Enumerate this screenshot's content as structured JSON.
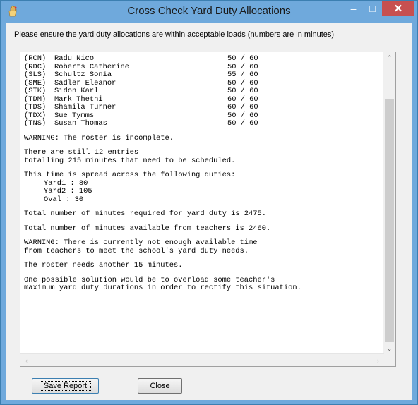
{
  "window": {
    "title": "Cross Check Yard Duty Allocations",
    "minimize_glyph": "–",
    "maximize_glyph": "□",
    "close_glyph": "✕",
    "app_icon": "hand-icon"
  },
  "instruction": "Please ensure the yard duty allocations are within acceptable loads (numbers are in minutes)",
  "allocations": [
    {
      "code": "(RCN)",
      "name": "Radu Nico",
      "load": "50 / 60"
    },
    {
      "code": "(RDC)",
      "name": "Roberts Catherine",
      "load": "50 / 60"
    },
    {
      "code": "(SLS)",
      "name": "Schultz Sonia",
      "load": "55 / 60"
    },
    {
      "code": "(SME)",
      "name": "Sadler Eleanor",
      "load": "50 / 60"
    },
    {
      "code": "(STK)",
      "name": "Sidon Karl",
      "load": "50 / 60"
    },
    {
      "code": "(TDM)",
      "name": "Mark Thethi",
      "load": "60 / 60"
    },
    {
      "code": "(TDS)",
      "name": "Shamila Turner",
      "load": "60 / 60"
    },
    {
      "code": "(TDX)",
      "name": "Sue Tymms",
      "load": "50 / 60"
    },
    {
      "code": "(TNS)",
      "name": "Susan Thomas",
      "load": "50 / 60"
    }
  ],
  "report": {
    "warning_incomplete": "WARNING: The roster is incomplete.",
    "entries_line1": "There are still 12 entries",
    "entries_line2": "totalling 215 minutes that need to be scheduled.",
    "spread_intro": "This time is spread across the following duties:",
    "duties": [
      "Yard1 : 80",
      "Yard2 : 105",
      "Oval : 30"
    ],
    "total_required": "Total number of minutes required for yard duty is 2475.",
    "total_available": "Total number of minutes available from teachers is 2460.",
    "warning_time_line1": "WARNING: There is currently not enough available time",
    "warning_time_line2": "from teachers to meet the school's yard duty needs.",
    "needs_more": "The roster needs another 15 minutes.",
    "solution_line1": "One possible solution would be to overload some teacher's",
    "solution_line2": "maximum yard duty durations in order to rectify this situation."
  },
  "scrollbar": {
    "up_icon": "chevron-up-icon",
    "down_icon": "chevron-down-icon",
    "left_icon": "chevron-left-icon",
    "right_icon": "chevron-right-icon",
    "up_glyph": "⌃",
    "down_glyph": "⌄",
    "left_glyph": "‹",
    "right_glyph": "›"
  },
  "buttons": {
    "save_report": "Save Report",
    "close": "Close"
  },
  "colors": {
    "titlebar": "#6fa9dc",
    "close_button": "#c75050"
  }
}
